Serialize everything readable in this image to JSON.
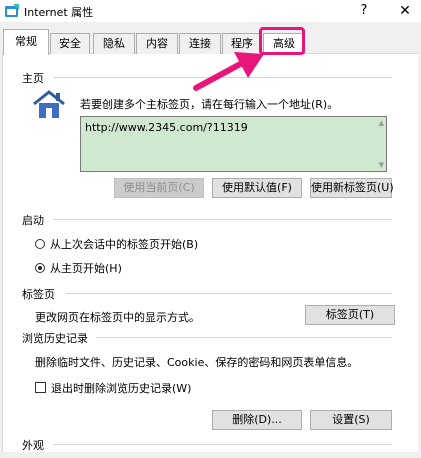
{
  "window": {
    "title": "Internet 属性",
    "help_label": "?",
    "close_label": "✕"
  },
  "tabs": [
    {
      "label": "常规",
      "selected": false
    },
    {
      "label": "安全",
      "selected": false
    },
    {
      "label": "隐私",
      "selected": false
    },
    {
      "label": "内容",
      "selected": false
    },
    {
      "label": "连接",
      "selected": false
    },
    {
      "label": "程序",
      "selected": false
    },
    {
      "label": "高级",
      "selected": true
    }
  ],
  "homepage": {
    "group_label": "主页",
    "instruction": "若要创建多个主标签页，请在每行输入一个地址(R)。",
    "url_value": "http://www.2345.com/?11319",
    "use_current_label": "使用当前页(C)",
    "use_default_label": "使用默认值(F)",
    "use_new_tab_label": "使用新标签页(U)"
  },
  "startup": {
    "group_label": "启动",
    "option_last_session": "从上次会话中的标签页开始(B)",
    "option_homepage": "从主页开始(H)",
    "selected": "homepage"
  },
  "tabs_section": {
    "group_label": "标签页",
    "description": "更改网页在标签页中的显示方式。",
    "button_label": "标签页(T)"
  },
  "history": {
    "group_label": "浏览历史记录",
    "description": "删除临时文件、历史记录、Cookie、保存的密码和网页表单信息。",
    "checkbox_label": "退出时删除浏览历史记录(W)",
    "checked": false,
    "delete_label": "删除(D)...",
    "settings_label": "设置(S)"
  },
  "appearance": {
    "group_label": "外观"
  },
  "colors": {
    "highlight": "#e8157a",
    "url_box_bg": "#cfe8cf"
  }
}
